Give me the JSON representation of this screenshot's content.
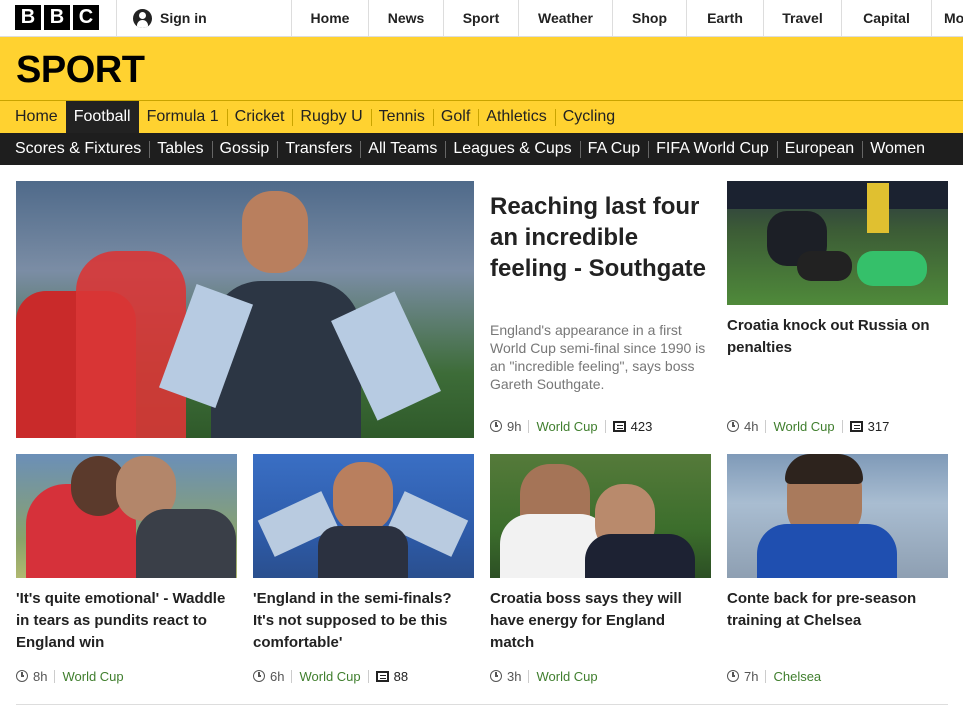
{
  "brand": {
    "letters": [
      "B",
      "B",
      "C"
    ]
  },
  "account": {
    "signin_label": "Sign in"
  },
  "top_nav": [
    {
      "label": "Home"
    },
    {
      "label": "News"
    },
    {
      "label": "Sport"
    },
    {
      "label": "Weather"
    },
    {
      "label": "Shop"
    },
    {
      "label": "Earth"
    },
    {
      "label": "Travel"
    },
    {
      "label": "Capital"
    },
    {
      "label": "Mo"
    }
  ],
  "section_title": "SPORT",
  "sport_nav": [
    {
      "label": "Home",
      "active": false
    },
    {
      "label": "Football",
      "active": true
    },
    {
      "label": "Formula 1",
      "active": false
    },
    {
      "label": "Cricket",
      "active": false
    },
    {
      "label": "Rugby U",
      "active": false
    },
    {
      "label": "Tennis",
      "active": false
    },
    {
      "label": "Golf",
      "active": false
    },
    {
      "label": "Athletics",
      "active": false
    },
    {
      "label": "Cycling",
      "active": false
    }
  ],
  "football_nav": [
    {
      "label": "Scores & Fixtures"
    },
    {
      "label": "Tables"
    },
    {
      "label": "Gossip"
    },
    {
      "label": "Transfers"
    },
    {
      "label": "All Teams"
    },
    {
      "label": "Leagues & Cups"
    },
    {
      "label": "FA Cup"
    },
    {
      "label": "FIFA World Cup"
    },
    {
      "label": "European"
    },
    {
      "label": "Women"
    }
  ],
  "lead": {
    "title": "Reaching last four an incredible feeling - Southgate",
    "summary": "England's appearance in a first World Cup semi-final since 1990 is an \"incredible feeling\", says boss Gareth Southgate.",
    "time": "9h",
    "section": "World Cup",
    "comments": "423"
  },
  "cards": [
    {
      "title": "Croatia knock out Russia on penalties",
      "time": "4h",
      "section": "World Cup",
      "comments": "317"
    },
    {
      "title": "'It's quite emotional' - Waddle in tears as pundits react to England win",
      "time": "8h",
      "section": "World Cup"
    },
    {
      "title": "'England in the semi-finals? It's not supposed to be this comfortable'",
      "time": "6h",
      "section": "World Cup",
      "comments": "88"
    },
    {
      "title": "Croatia boss says they will have energy for England match",
      "time": "3h",
      "section": "World Cup"
    },
    {
      "title": "Conte back for pre-season training at Chelsea",
      "time": "7h",
      "section": "Chelsea"
    }
  ],
  "colors": {
    "sport_yellow": "#ffd230",
    "section_green": "#3f7e2d",
    "subnav_dark": "#1e1e1e"
  },
  "icons": [
    "user-icon",
    "clock-icon",
    "comments-icon"
  ]
}
